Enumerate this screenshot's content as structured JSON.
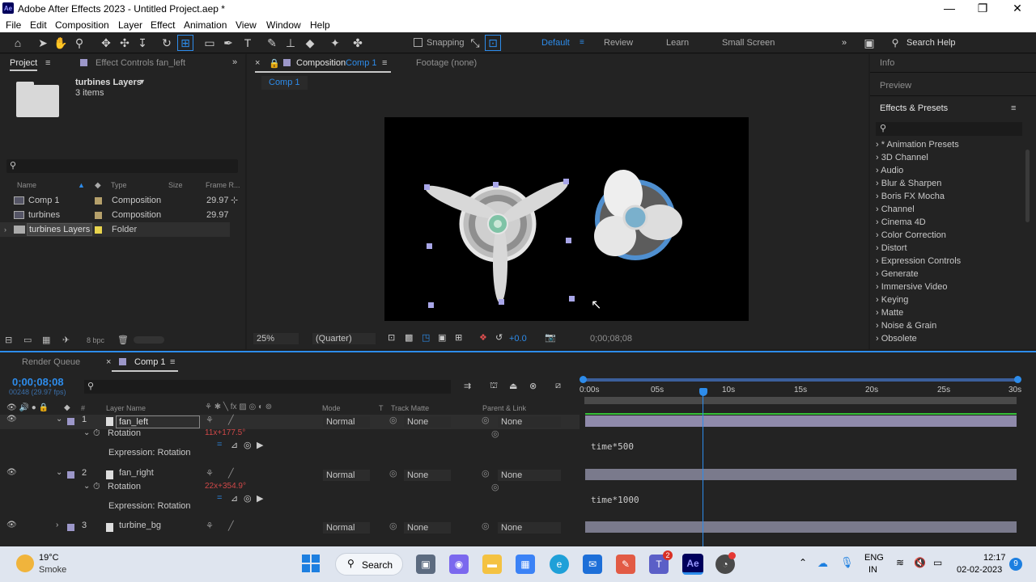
{
  "window": {
    "title": "Adobe After Effects 2023 - Untitled Project.aep *",
    "logo": "Ae",
    "minimize": "—",
    "maximize": "❐",
    "close": "✕"
  },
  "menu": [
    "File",
    "Edit",
    "Composition",
    "Layer",
    "Effect",
    "Animation",
    "View",
    "Window",
    "Help"
  ],
  "toolbar": {
    "snapping_label": "Snapping",
    "workspaces": [
      "Default",
      "Review",
      "Learn",
      "Small Screen"
    ],
    "active_workspace": "Default",
    "search_placeholder": "Search Help"
  },
  "project_panel": {
    "tab_project": "Project",
    "tab_effect_controls": "Effect Controls fan_left",
    "folder_name": "turbines Layers",
    "folder_items": "3 items",
    "columns": [
      "Name",
      "Type",
      "Size",
      "Frame R..."
    ],
    "items": [
      {
        "name": "Comp 1",
        "type": "Composition",
        "fps": "29.97",
        "color": "#b5a06b"
      },
      {
        "name": "turbines",
        "type": "Composition",
        "fps": "29.97",
        "color": "#b5a06b"
      },
      {
        "name": "turbines Layers",
        "type": "Folder",
        "fps": "",
        "color": "#e8d44d"
      }
    ],
    "bpc": "8 bpc"
  },
  "comp_panel": {
    "tab_label": "Composition",
    "tab_comp": "Comp 1",
    "footage_tab": "Footage (none)",
    "breadcrumb": "Comp 1",
    "zoom": "25%",
    "resolution": "(Quarter)",
    "exposure": "+0.0",
    "timecode": "0;00;08;08"
  },
  "right_panel": {
    "info": "Info",
    "preview": "Preview",
    "effects_title": "Effects & Presets",
    "effects": [
      "* Animation Presets",
      "3D Channel",
      "Audio",
      "Blur & Sharpen",
      "Boris FX Mocha",
      "Channel",
      "Cinema 4D",
      "Color Correction",
      "Distort",
      "Expression Controls",
      "Generate",
      "Immersive Video",
      "Keying",
      "Matte",
      "Noise & Grain",
      "Obsolete"
    ]
  },
  "timeline": {
    "render_queue": "Render Queue",
    "comp_tab": "Comp 1",
    "current_time": "0;00;08;08",
    "frame_info": "00248 (29.97 fps)",
    "col_layer_name": "Layer Name",
    "col_mode": "Mode",
    "col_t": "T",
    "col_track_matte": "Track Matte",
    "col_parent": "Parent & Link",
    "col_num": "#",
    "ruler": [
      "0:00s",
      "05s",
      "10s",
      "15s",
      "20s",
      "25s",
      "30s"
    ],
    "playhead_seconds": 8.28,
    "duration_seconds": 30,
    "layers": [
      {
        "num": "1",
        "name": "fan_left",
        "mode": "Normal",
        "matte": "None",
        "parent": "None",
        "rotation_label": "Rotation",
        "rotation_value": "11x+177.5°",
        "expr_label": "Expression: Rotation",
        "expression": "time*500"
      },
      {
        "num": "2",
        "name": "fan_right",
        "mode": "Normal",
        "matte": "None",
        "parent": "None",
        "rotation_label": "Rotation",
        "rotation_value": "22x+354.9°",
        "expr_label": "Expression: Rotation",
        "expression": "time*1000"
      },
      {
        "num": "3",
        "name": "turbine_bg",
        "mode": "Normal",
        "matte": "None",
        "parent": "None"
      }
    ]
  },
  "taskbar": {
    "temp": "19°C",
    "weather": "Smoke",
    "search": "Search",
    "lang1": "ENG",
    "lang2": "IN",
    "time": "12:17",
    "date": "02-02-2023",
    "notif_count": "9",
    "teams_badge": "2"
  }
}
